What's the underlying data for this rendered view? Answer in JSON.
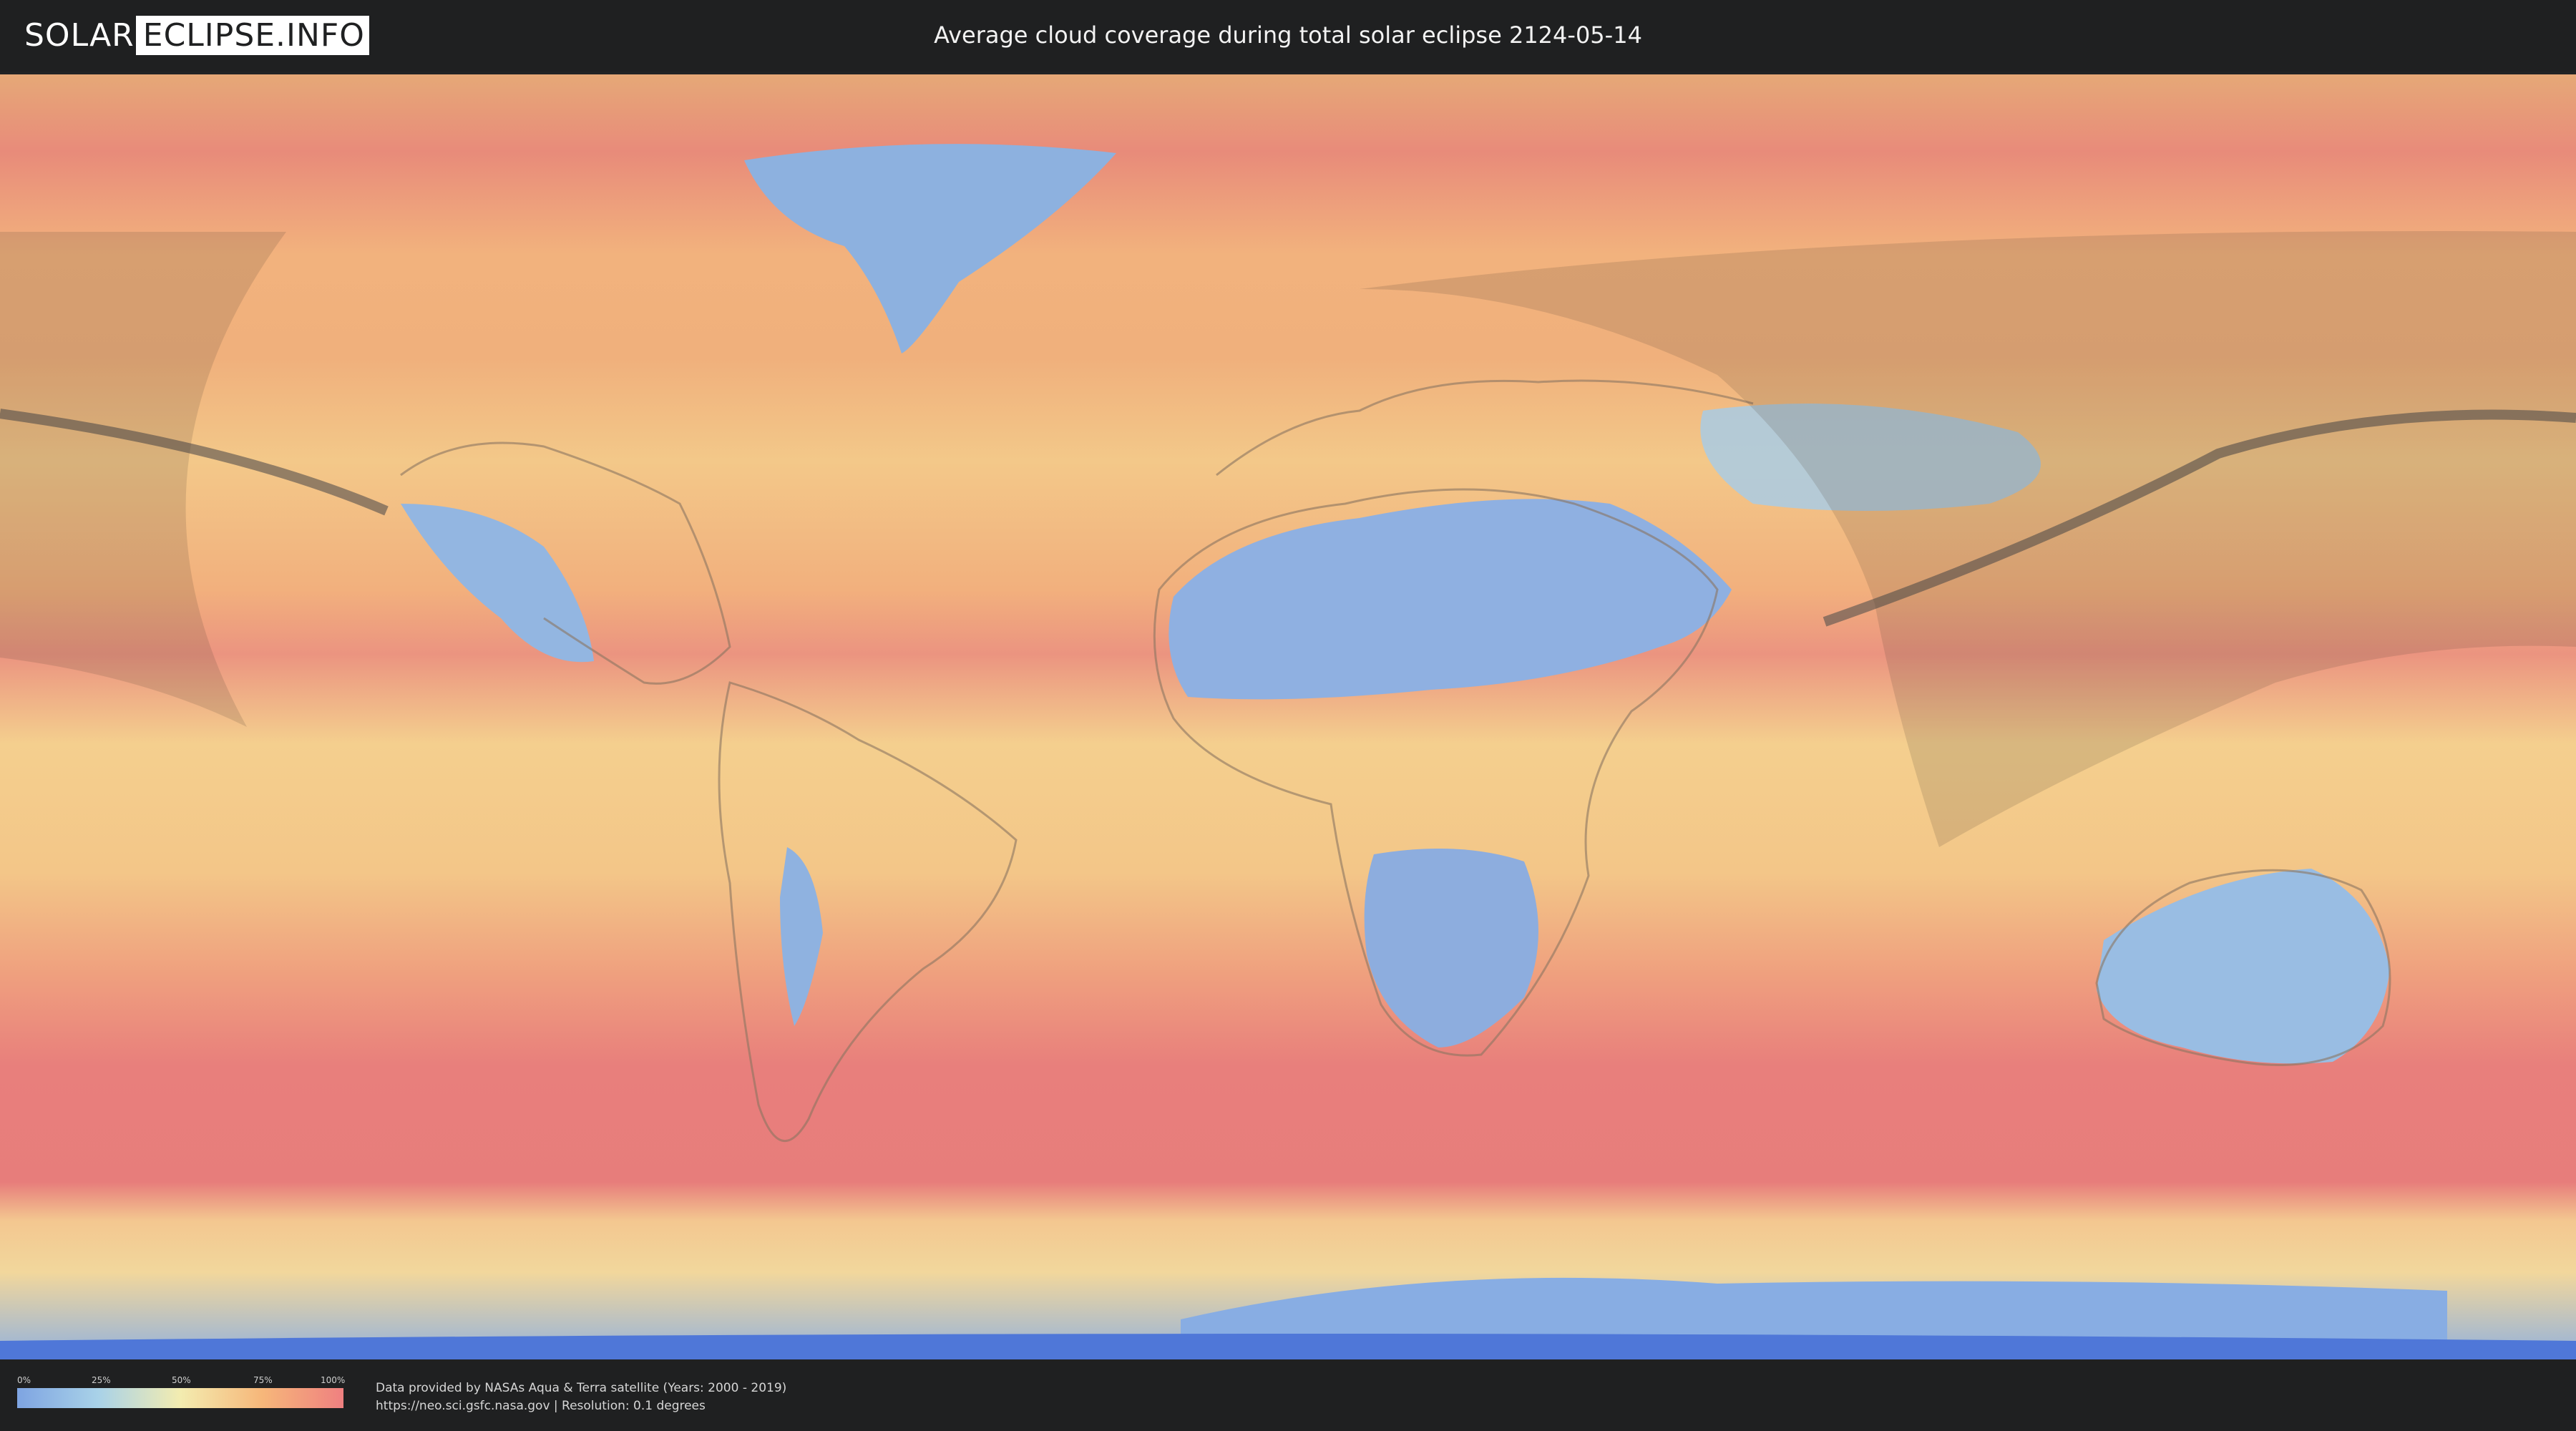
{
  "header": {
    "logo_part1": "SOLAR",
    "logo_part2": "ECLIPSE.INFO",
    "title": "Average cloud coverage during total solar eclipse 2124-05-14"
  },
  "legend": {
    "ticks": [
      "0%",
      "25%",
      "50%",
      "75%",
      "100%"
    ],
    "gradient_colors": [
      "#7ea4e2",
      "#a9d2e8",
      "#f3ecb0",
      "#f6b77a",
      "#ef8080"
    ]
  },
  "credits": {
    "line1": "Data provided by NASAs Aqua & Terra satellite (Years: 2000 - 2019)",
    "line2": "https://neo.sci.gsfc.nasa.gov | Resolution: 0.1 degrees"
  },
  "colors": {
    "clear_sky": "#7ea4e2",
    "overcast": "#ef8080",
    "eclipse_path": "#5f5851",
    "background": "#1f2021"
  }
}
